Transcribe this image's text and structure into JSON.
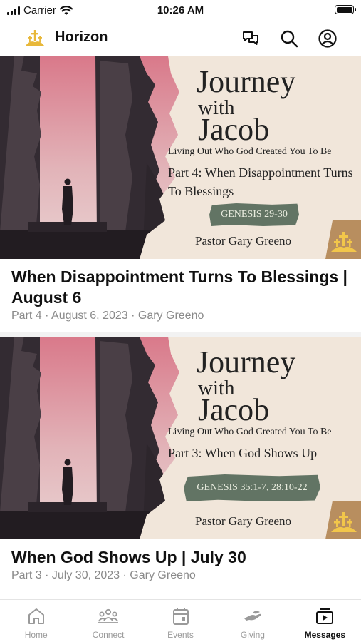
{
  "status_bar": {
    "carrier": "Carrier",
    "time": "10:26 AM"
  },
  "header": {
    "title": "Horizon",
    "logo_icon": "church-logo-icon",
    "actions": [
      "chat-icon",
      "search-icon",
      "profile-icon"
    ]
  },
  "messages": [
    {
      "banner": {
        "journey": "Journey",
        "with": "with",
        "jacob": "Jacob",
        "tagline": "Living Out Who God Created You To Be",
        "part": "Part 4: When Disappointment Turns To Blessings",
        "scripture": "GENESIS 29-30",
        "pastor": "Pastor Gary Greeno"
      },
      "title": "When Disappointment Turns To Blessings | August 6",
      "meta": "Part 4 · August 6, 2023 · Gary Greeno"
    },
    {
      "banner": {
        "journey": "Journey",
        "with": "with",
        "jacob": "Jacob",
        "tagline": "Living Out Who God Created You To Be",
        "part": "Part 3: When God Shows Up",
        "scripture": "GENESIS 35:1-7, 28:10-22",
        "pastor": "Pastor Gary Greeno"
      },
      "title": "When God Shows Up | July 30",
      "meta": "Part 3 · July 30, 2023 · Gary Greeno"
    }
  ],
  "tabs": [
    {
      "label": "Home",
      "icon": "home-icon",
      "active": false
    },
    {
      "label": "Connect",
      "icon": "people-icon",
      "active": false
    },
    {
      "label": "Events",
      "icon": "calendar-icon",
      "active": false
    },
    {
      "label": "Giving",
      "icon": "giving-hand-icon",
      "active": false
    },
    {
      "label": "Messages",
      "icon": "video-play-icon",
      "active": true
    }
  ],
  "colors": {
    "banner_bg": "#f1e6da",
    "scripture_badge": "#627464",
    "logo_gold": "#e8b83a",
    "tab_inactive": "#9a9a9a",
    "tab_active": "#111111"
  }
}
